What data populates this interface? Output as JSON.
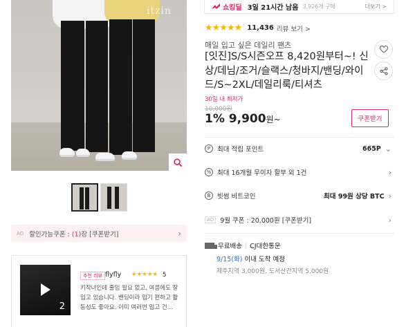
{
  "gallery": {
    "brand_text": "itzin",
    "zoom_icon": "search-icon",
    "thumbnails": [
      {
        "active": true
      },
      {
        "active": false
      }
    ]
  },
  "coupon_banner": {
    "ad_label": "AD",
    "text_prefix": "할인가능쿠폰 : ",
    "count": "(1)",
    "text_suffix": "장 [쿠폰받기]"
  },
  "review": {
    "video_count": "2",
    "badge": "추천 리뷰",
    "user": "flyfly",
    "stars": "★★★★★",
    "score": "5",
    "text": "키작녀인데 줄임 필요 없고, 여름에도 잘 입고 있습니다. 밴딩이라 입기 편하고 활동성도 좋아요. 이미 여러번 입고 건…"
  },
  "deal": {
    "name": "쇼킹딜",
    "time_left": "3일 21시간 남음",
    "sold": "3,926개 구매",
    "more": "더보기 >"
  },
  "rating": {
    "stars": "★★★★★",
    "value": 4.5,
    "count": "11,436",
    "more": "리뷰 보기 >"
  },
  "product": {
    "subtitle": "매일 입고 싶은 데일리 팬츠",
    "title": "[잇진]S/S시즌오프 8,420원부터~! 신상/데님/조거/슬랙스/청바지/밴딩/와이드/S~2XL/데일리룩/티셔츠",
    "lowest_label": "30일 내 최저가",
    "original_price": "10,000원",
    "discount_rate": "1%",
    "price": "9,900",
    "price_unit": "원~",
    "coupon_button": "쿠폰받기"
  },
  "info": {
    "points_label": "최대 적립 포인트",
    "points_value": "665P",
    "installment_label": "최대 16개월 무이자 할부 외 1건",
    "bitcoin_label": "빗썸 비트코인",
    "bitcoin_value": "최대 99원 상당 BTC",
    "coupon_ad_label": "AD",
    "coupon_label": "9월 쿠폰 : 20,000원 [쿠폰받기]"
  },
  "shipping": {
    "type": "무료배송",
    "carrier": "CJ대한통운",
    "date": "9/15(화)",
    "date_suffix": " 이내 도착 예정",
    "extra": "제주지역 3,000원, 도서산간지역 5,000원"
  },
  "colors": {
    "accent": "#e0245e",
    "star": "#f5b800",
    "link_blue": "#2f6fd6"
  }
}
